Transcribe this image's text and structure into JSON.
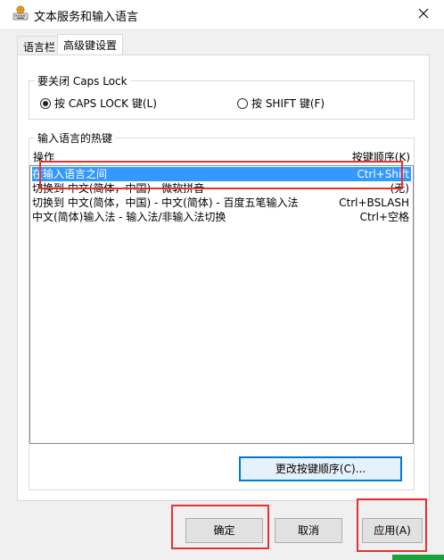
{
  "window": {
    "title": "文本服务和输入语言",
    "app_icon": "keyboard-globe-icon",
    "close_icon": "close-icon"
  },
  "tabs": [
    {
      "label": "语言栏",
      "active": false
    },
    {
      "label": "高级键设置",
      "active": true
    }
  ],
  "caps_lock_group": {
    "title": "要关闭 Caps Lock",
    "option_capslock": "按 CAPS LOCK 键(L)",
    "option_shift": "按 SHIFT 键(F)",
    "selected": "capslock"
  },
  "hotkeys_group": {
    "title": "输入语言的热键",
    "col_action": "操作",
    "col_sequence": "按键顺序(K)",
    "rows": [
      {
        "action": "在输入语言之间",
        "hotkey": "Ctrl+Shift",
        "selected": true
      },
      {
        "action": "切换到 中文(简体，中国) - 微软拼音",
        "hotkey": "(无)",
        "selected": false
      },
      {
        "action": "切换到 中文(简体，中国) - 中文(简体) - 百度五笔输入法",
        "hotkey": "Ctrl+BSLASH",
        "selected": false
      },
      {
        "action": "中文(简体)输入法 - 输入法/非输入法切换",
        "hotkey": "Ctrl+空格",
        "selected": false
      }
    ],
    "change_sequence_button": "更改按键顺序(C)..."
  },
  "footer": {
    "ok": "确定",
    "cancel": "取消",
    "apply": "应用(A)"
  },
  "colors": {
    "selection": "#3399ff",
    "annotation": "#e8302f",
    "focus": "#0078d7"
  }
}
